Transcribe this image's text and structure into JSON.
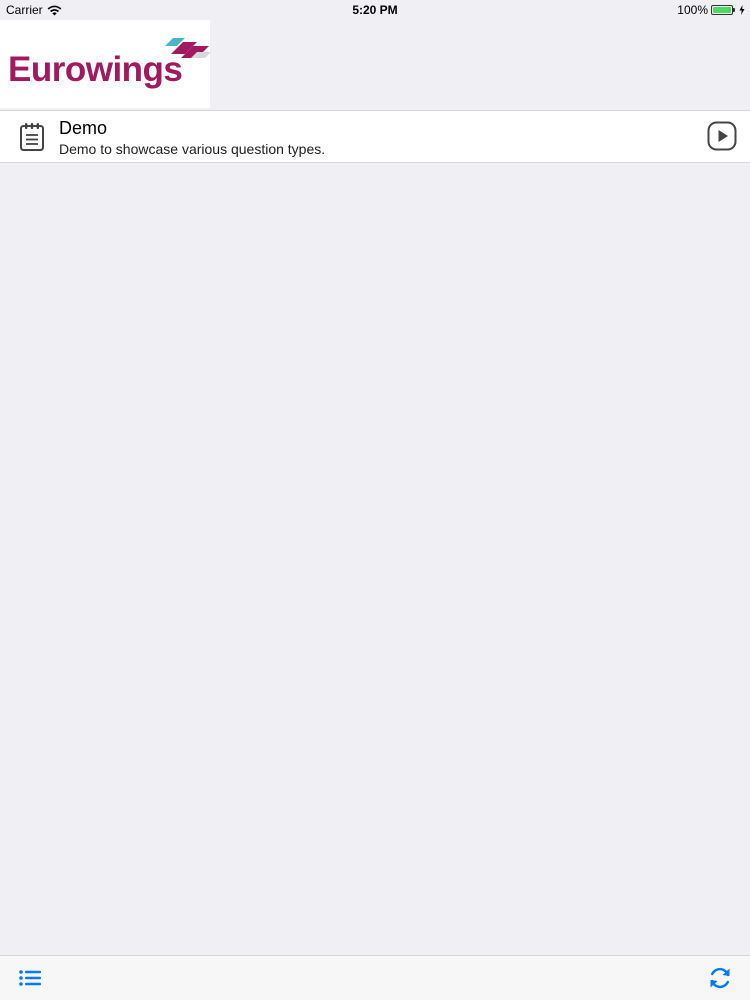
{
  "status_bar": {
    "carrier": "Carrier",
    "time": "5:20 PM",
    "battery": "100%",
    "battery_level": 1.0
  },
  "header": {
    "logo_text": "Eurowings"
  },
  "list": {
    "items": [
      {
        "title": "Demo",
        "subtitle": "Demo to showcase various question types.",
        "icon": "clipboard-icon",
        "action_icon": "play-circle-icon"
      }
    ]
  },
  "toolbar": {
    "left_icon": "list-icon",
    "right_icon": "refresh-icon"
  },
  "colors": {
    "background": "#efeff4",
    "brand": "#a1195f",
    "accent_blue": "#007aff",
    "battery_green": "#4cd964"
  }
}
